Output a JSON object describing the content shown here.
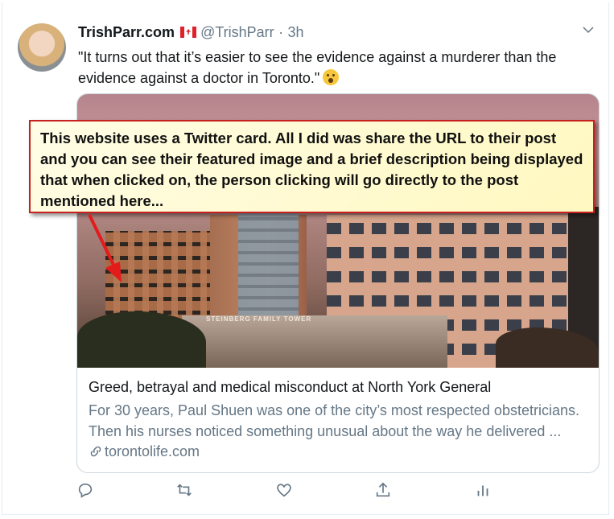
{
  "tweet": {
    "display_name": "TrishParr.com",
    "handle": "@TrishParr",
    "separator": "·",
    "time": "3h",
    "text": "\"It turns out that it’s easier to see the evidence against a murderer than the evidence against a doctor in Toronto.\"",
    "flag_icon": "canada-flag-icon",
    "emoji_icon": "surprised-face-emoji"
  },
  "card": {
    "image_sign": "STEINBERG FAMILY TOWER",
    "title": "Greed, betrayal and medical misconduct at North York General",
    "description_line1": "For 30 years, Paul Shuen was one of the city’s most respected obstetricians.",
    "description_line2": "Then his nurses noticed something unusual about the way he delivered ...",
    "domain": "torontolife.com"
  },
  "annotation": {
    "text": "This website uses a Twitter card. All I did was share the URL to their post and you can see their featured image and a brief description being displayed that when clicked on, the person clicking will go directly to the post mentioned here...",
    "border_color": "#c8201e",
    "background_color": "#fffbd0"
  },
  "actions": [
    "reply-icon",
    "retweet-icon",
    "like-icon",
    "share-icon",
    "analytics-icon"
  ],
  "colors": {
    "secondary_text": "#657786",
    "primary_text": "#14171a",
    "border": "#ccd6dd"
  }
}
